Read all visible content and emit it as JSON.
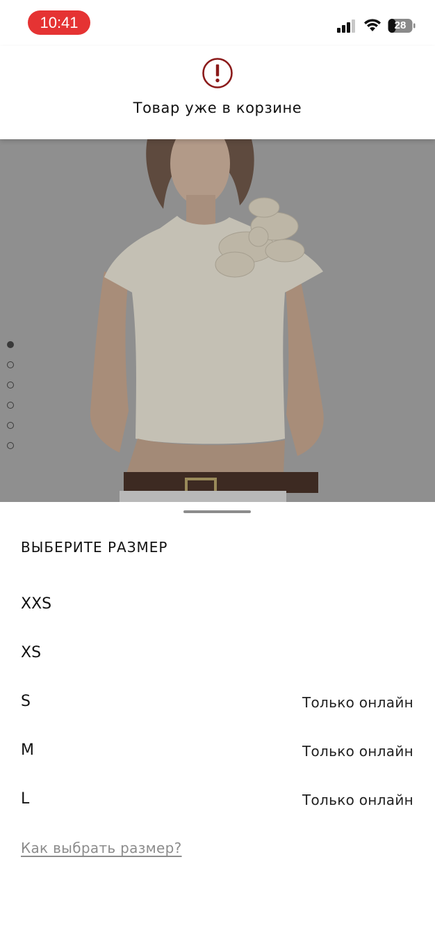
{
  "status_bar": {
    "time": "10:41",
    "battery_level": "28",
    "time_pill_color": "#e53333"
  },
  "toast": {
    "icon": "exclamation-circle-icon",
    "icon_color": "#8b1a1a",
    "message": "Товар уже в корзине"
  },
  "gallery": {
    "image": "product-photo-white-tshirt-flower-applique",
    "image_count": 6,
    "active_index": 0
  },
  "size_sheet": {
    "title": "ВЫБЕРИТЕ РАЗМЕР",
    "sizes": [
      {
        "label": "XXS",
        "note": ""
      },
      {
        "label": "XS",
        "note": ""
      },
      {
        "label": "S",
        "note": "Только онлайн"
      },
      {
        "label": "M",
        "note": "Только онлайн"
      },
      {
        "label": "L",
        "note": "Только онлайн"
      }
    ],
    "guide_link": "Как выбрать размер?"
  }
}
